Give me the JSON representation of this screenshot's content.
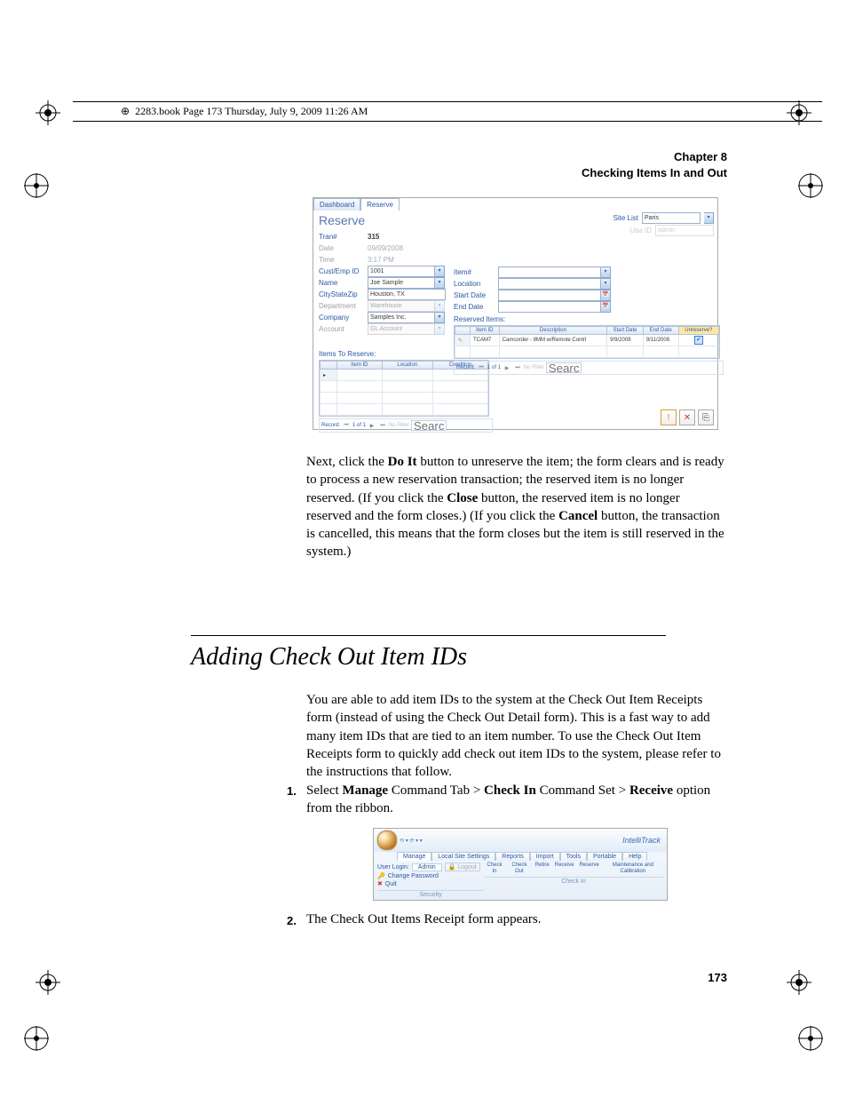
{
  "book_header": "2283.book  Page 173  Thursday, July 9, 2009  11:26 AM",
  "running_head": {
    "chapter": "Chapter 8",
    "title": "Checking Items In and Out"
  },
  "figure1": {
    "tabs": {
      "dashboard": "Dashboard",
      "reserve": "Reserve"
    },
    "window_title": "Reserve",
    "site_list_label": "Site List",
    "site_list_value": "Paris",
    "usa_id_label": "Usa ID",
    "usa_id_value": "admin",
    "left_fields": {
      "tran_no": {
        "label": "Tran#",
        "value": "315"
      },
      "date": {
        "label": "Date",
        "value": "09/09/2008"
      },
      "time": {
        "label": "Time",
        "value": "3:17 PM"
      },
      "cust_emp_id": {
        "label": "Cust/Emp ID",
        "value": "1001"
      },
      "name": {
        "label": "Name",
        "value": "Joe Sample"
      },
      "city_state_zip": {
        "label": "CityStateZip",
        "value": "Houston, TX"
      },
      "department": {
        "label": "Department",
        "value": "Warehouse"
      },
      "company": {
        "label": "Company",
        "value": "Samples Inc."
      },
      "account": {
        "label": "Account",
        "value": "GL Account"
      }
    },
    "right_fields": {
      "item_no": {
        "label": "Item#",
        "value": ""
      },
      "location": {
        "label": "Location",
        "value": ""
      },
      "start_date": {
        "label": "Start Date",
        "value": ""
      },
      "end_date": {
        "label": "End Date",
        "value": ""
      }
    },
    "reserved_items": {
      "heading": "Reserved Items:",
      "cols": {
        "item_id": "Item ID",
        "description": "Description",
        "start_date": "Start Date",
        "end_date": "End Date",
        "unreserve": "Unreserve?"
      },
      "rows": [
        {
          "item_id": "TCAM7",
          "description": "Camcorder - 8MM w/Remote Contrl",
          "start_date": "9/9/2008",
          "end_date": "9/11/2008",
          "unreserve": "✔"
        }
      ],
      "nav": {
        "label": "Record:",
        "pos": "1 of 1",
        "filter": "No Filter",
        "search": "Search"
      }
    },
    "items_to_reserve": {
      "heading": "Items To Reserve:",
      "cols": {
        "item_id": "Item ID",
        "location": "Location",
        "condition": "Condition"
      },
      "nav": {
        "label": "Record:",
        "pos": "1 of 1",
        "filter": "No Filter",
        "search": "Search"
      }
    },
    "buttons": {
      "doit": "!",
      "close": "✕",
      "cancel": "⎘"
    }
  },
  "body_para_1_a": "Next, click the ",
  "body_para_1_b": "Do It",
  "body_para_1_c": " button to unreserve the item; the form clears and is ready to process a new reservation transaction; the reserved item is no longer reserved. (If you click the ",
  "body_para_1_d": "Close",
  "body_para_1_e": " button, the reserved item is no longer reserved and the form closes.) (If you click the ",
  "body_para_1_f": "Cancel",
  "body_para_1_g": " button, the transaction is cancelled, this means that the form closes but the item is still reserved in the system.)",
  "section_heading": "Adding Check Out Item IDs",
  "para2": "You are able to add item IDs to the system at the Check Out Item Receipts form (instead of using the Check Out Detail form). This is a fast way to add many item IDs that are tied to an item number. To use the Check Out Item Receipts form to quickly add check out item IDs to the system, please refer to the instructions that follow.",
  "step1": {
    "num": "1.",
    "a": "Select ",
    "b": "Manage",
    "c": " Command Tab > ",
    "d": "Check In",
    "e": " Command Set > ",
    "f": "Receive",
    "g": " option from the ribbon."
  },
  "figure2": {
    "app_title": "IntelliTrack",
    "tabs": [
      "Manage",
      "Local Site Settings",
      "Reports",
      "Import",
      "Tools",
      "Portable",
      "Help"
    ],
    "user_login_label": "User Login:",
    "user_login_value": "Admin",
    "logout": "Logout",
    "change_pw": "Change Password",
    "quit": "Quit",
    "security_label": "Security",
    "commands": [
      "Check In",
      "Check Out",
      "Retire",
      "Receive",
      "Reserve",
      "Maintenance and Calibration"
    ],
    "checkin_label": "Check In"
  },
  "step2": {
    "num": "2.",
    "text": "The Check Out Items Receipt form appears."
  },
  "page_number": "173"
}
